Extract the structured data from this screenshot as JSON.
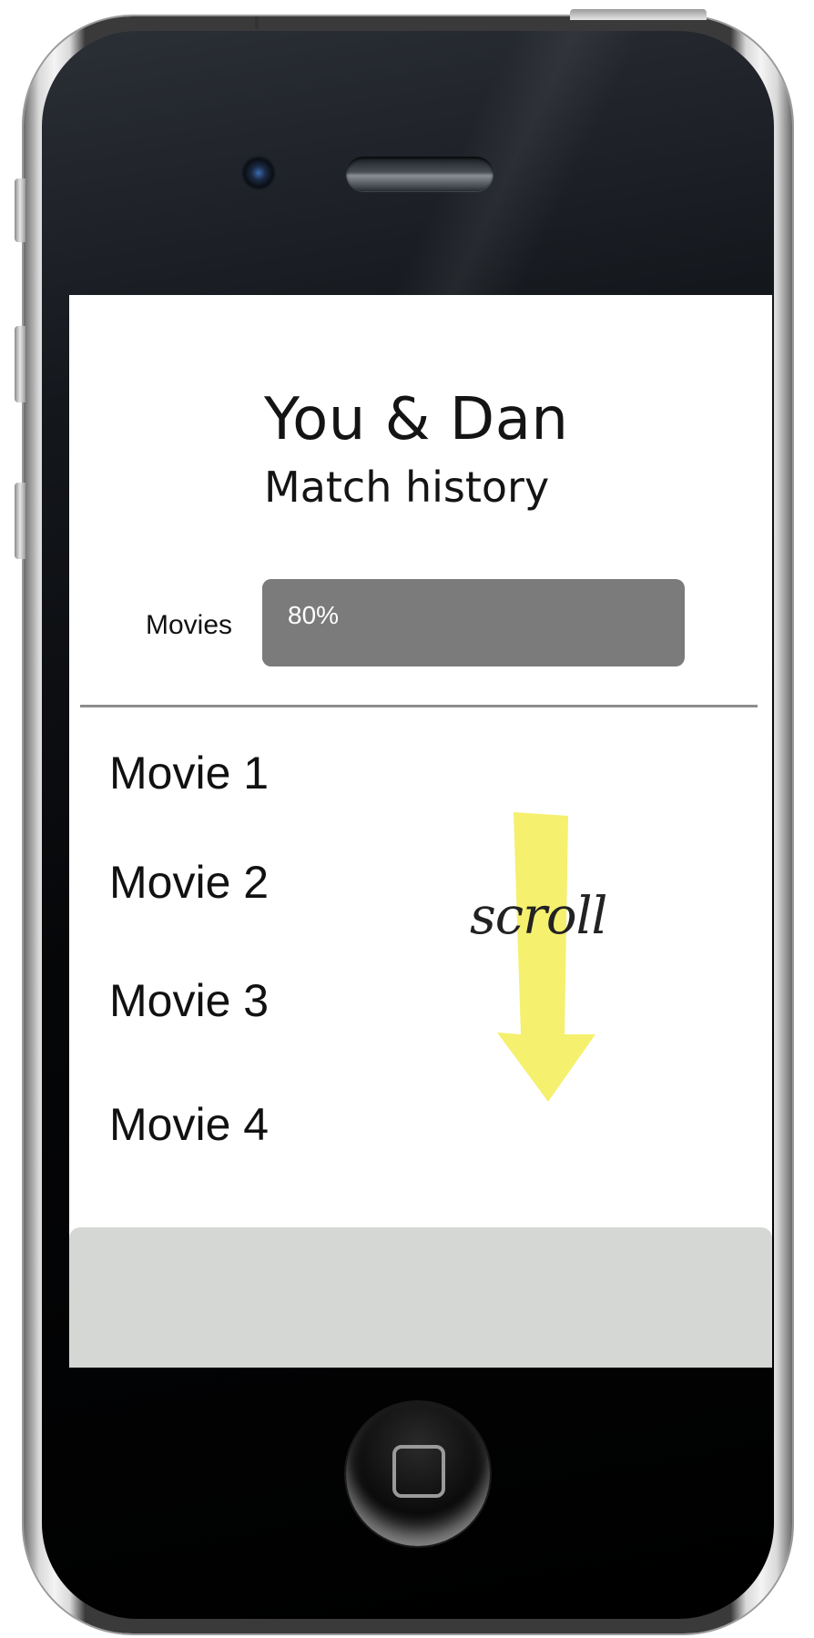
{
  "header": {
    "title": "You & Dan",
    "subtitle": "Match history"
  },
  "match": {
    "category_label": "Movies",
    "percent_label": "80%",
    "percent_value": 80
  },
  "movies": [
    {
      "label": "Movie 1"
    },
    {
      "label": "Movie 2"
    },
    {
      "label": "Movie 3"
    },
    {
      "label": "Movie 4"
    }
  ],
  "annotation": {
    "scroll_label": "scroll",
    "arrow_color": "#f5f06e",
    "arrow_icon": "arrow-down-icon"
  },
  "colors": {
    "progress_bar": "#7b7b7b",
    "bottom_bar": "#d4d7d4",
    "screen_bg": "#ffffff"
  },
  "device": {
    "home_icon": "home-button-icon",
    "camera_icon": "camera-icon",
    "speaker_icon": "speaker-icon"
  }
}
